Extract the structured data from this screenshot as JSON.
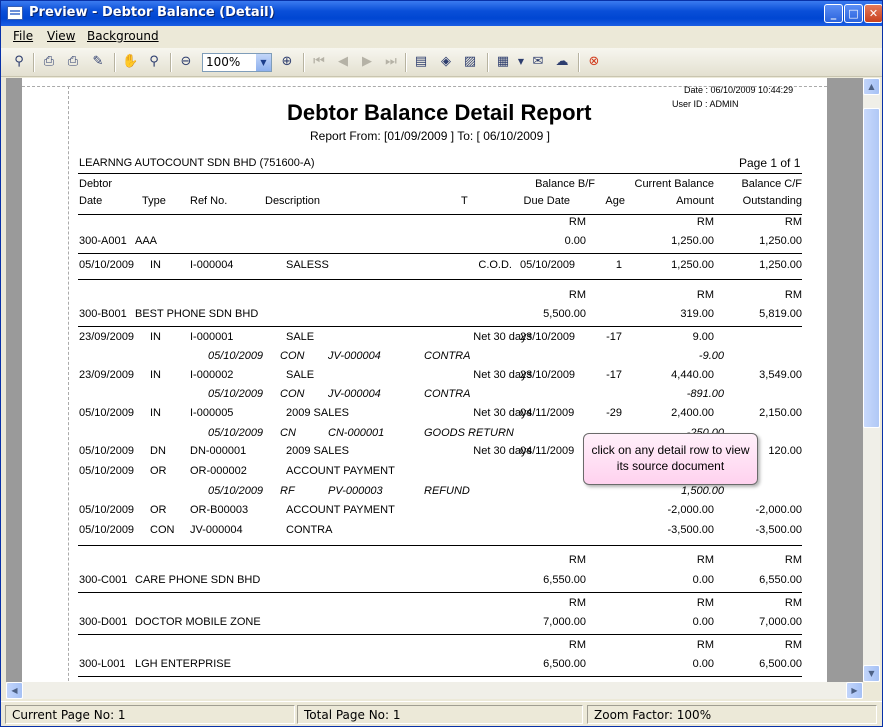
{
  "window": {
    "title": "Preview - Debtor Balance (Detail)"
  },
  "menu": [
    "File",
    "View",
    "Background"
  ],
  "toolbar": {
    "zoom": "100%"
  },
  "report": {
    "date_line": "Date :  06/10/2009 10:44:29",
    "user_line": "User ID :  ADMIN",
    "title": "Debtor Balance Detail Report",
    "range": "Report From: [01/09/2009   ] To: [  06/10/2009   ]",
    "company": "LEARNNG AUTOCOUNT SDN BHD (751600-A)",
    "page_info": "Page 1 of 1",
    "headers_top": {
      "debtor": "Debtor",
      "bal_bf": "Balance B/F",
      "cur_bal": "Current Balance",
      "bal_cf": "Balance C/F"
    },
    "headers_bottom": {
      "date": "Date",
      "type": "Type",
      "ref": "Ref No.",
      "desc": "Description",
      "t": "T",
      "due": "Due Date",
      "age": "Age",
      "amount": "Amount",
      "outstanding": "Outstanding"
    },
    "currency": "RM",
    "debtors": [
      {
        "code": "300-A001",
        "name": "AAA",
        "bf": "0.00",
        "cur": "1,250.00",
        "cf": "1,250.00"
      },
      {
        "code": "300-B001",
        "name": "BEST PHONE SDN BHD",
        "bf": "5,500.00",
        "cur": "319.00",
        "cf": "5,819.00"
      },
      {
        "code": "300-C001",
        "name": "CARE PHONE SDN BHD",
        "bf": "6,550.00",
        "cur": "0.00",
        "cf": "6,550.00"
      },
      {
        "code": "300-D001",
        "name": "DOCTOR MOBILE ZONE",
        "bf": "7,000.00",
        "cur": "0.00",
        "cf": "7,000.00"
      },
      {
        "code": "300-L001",
        "name": "LGH ENTERPRISE",
        "bf": "6,500.00",
        "cur": "0.00",
        "cf": "6,500.00"
      }
    ],
    "rows": [
      {
        "date": "05/10/2009",
        "type": "IN",
        "ref": "I-000004",
        "desc": "SALESS",
        "t": "C.O.D.",
        "due": "05/10/2009",
        "age": "1",
        "amount": "1,250.00",
        "out": "1,250.00"
      },
      {
        "date": "23/09/2009",
        "type": "IN",
        "ref": "I-000001",
        "desc": "SALE",
        "t": "Net 30 days",
        "due": "23/10/2009",
        "age": "-17",
        "amount": "9.00",
        "out": ""
      },
      {
        "date": "05/10/2009",
        "type": "CON",
        "ref": "JV-000004",
        "desc": "CONTRA",
        "amount": "-9.00"
      },
      {
        "date": "23/09/2009",
        "type": "IN",
        "ref": "I-000002",
        "desc": "SALE",
        "t": "Net 30 days",
        "due": "23/10/2009",
        "age": "-17",
        "amount": "4,440.00",
        "out": "3,549.00"
      },
      {
        "date": "05/10/2009",
        "type": "CON",
        "ref": "JV-000004",
        "desc": "CONTRA",
        "amount": "-891.00"
      },
      {
        "date": "05/10/2009",
        "type": "IN",
        "ref": "I-000005",
        "desc": "2009 SALES",
        "t": "Net 30 days",
        "due": "04/11/2009",
        "age": "-29",
        "amount": "2,400.00",
        "out": "2,150.00"
      },
      {
        "date": "05/10/2009",
        "type": "CN",
        "ref": "CN-000001",
        "desc": "GOODS RETURN",
        "amount": "-250.00"
      },
      {
        "date": "05/10/2009",
        "type": "DN",
        "ref": "DN-000001",
        "desc": "2009 SALES",
        "t": "Net 30 days",
        "due": "04/11/2009",
        "age": "",
        "amount": "",
        "out": "120.00"
      },
      {
        "date": "05/10/2009",
        "type": "OR",
        "ref": "OR-000002",
        "desc": "ACCOUNT PAYMENT",
        "amount": "",
        "out": ""
      },
      {
        "date": "05/10/2009",
        "type": "RF",
        "ref": "PV-000003",
        "desc": "REFUND",
        "amount": "1,500.00"
      },
      {
        "date": "05/10/2009",
        "type": "OR",
        "ref": "OR-B00003",
        "desc": "ACCOUNT PAYMENT",
        "amount": "-2,000.00",
        "out": "-2,000.00"
      },
      {
        "date": "05/10/2009",
        "type": "CON",
        "ref": "JV-000004",
        "desc": "CONTRA",
        "amount": "-3,500.00",
        "out": "-3,500.00"
      }
    ]
  },
  "tooltip": "click on any detail row to view its source document",
  "status": {
    "current": "Current Page No: 1",
    "total": "Total Page No: 1",
    "zoom": "Zoom Factor: 100%"
  }
}
